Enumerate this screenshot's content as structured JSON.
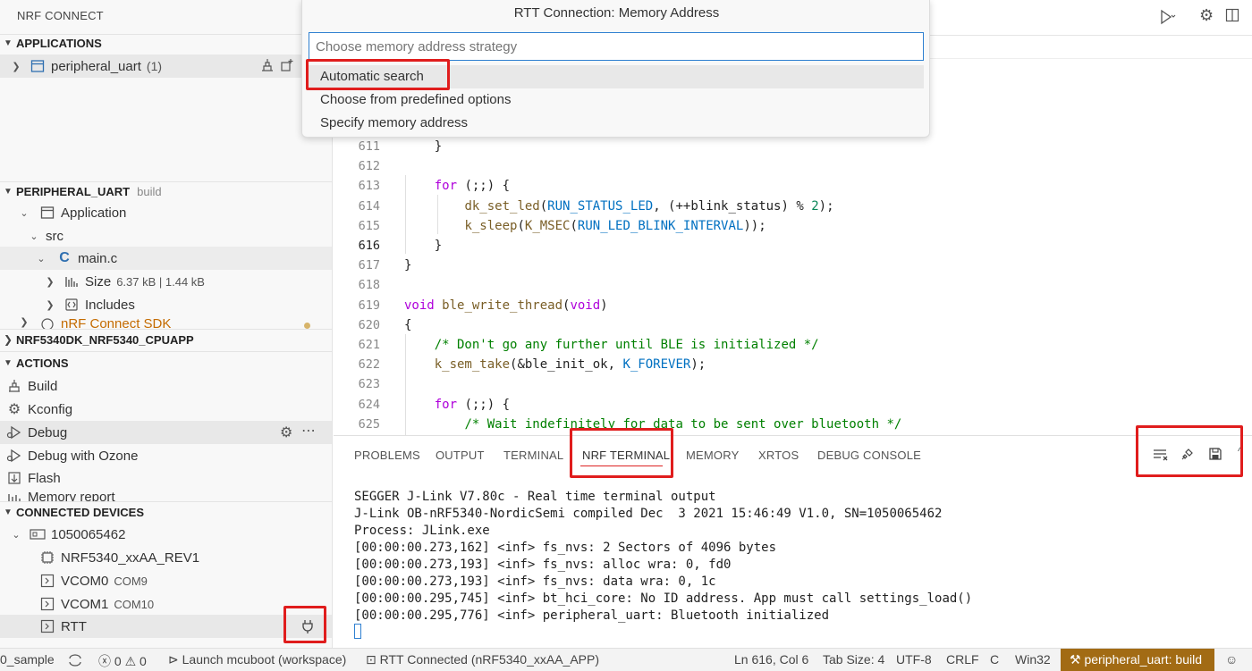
{
  "sidebar": {
    "title": "NRF CONNECT",
    "applications": {
      "header": "APPLICATIONS",
      "items": [
        {
          "label": "peripheral_uart",
          "count": "(1)"
        }
      ]
    },
    "peripheral": {
      "header": "PERIPHERAL_UART",
      "sub": "build",
      "tree": [
        {
          "label": "Application"
        },
        {
          "label": "src"
        },
        {
          "label": "main.c"
        },
        {
          "label": "Size",
          "detail": "6.37 kB | 1.44 kB"
        },
        {
          "label": "Includes"
        },
        {
          "label": "nRF Connect SDK"
        }
      ]
    },
    "board": {
      "header": "NRF5340DK_NRF5340_CPUAPP"
    },
    "actions": {
      "header": "ACTIONS",
      "items": [
        {
          "label": "Build"
        },
        {
          "label": "Kconfig"
        },
        {
          "label": "Debug"
        },
        {
          "label": "Debug with Ozone"
        },
        {
          "label": "Flash"
        },
        {
          "label": "Memory report"
        }
      ]
    },
    "devices": {
      "header": "CONNECTED DEVICES",
      "serial": "1050065462",
      "chip": "NRF5340_xxAA_REV1",
      "vcom0": {
        "label": "VCOM0",
        "port": "COM9"
      },
      "vcom1": {
        "label": "VCOM1",
        "port": "COM10"
      },
      "rtt": "RTT"
    }
  },
  "quickpick": {
    "title": "RTT Connection: Memory Address",
    "placeholder": "Choose memory address strategy",
    "options": [
      "Automatic search",
      "Choose from predefined options",
      "Specify memory address"
    ]
  },
  "editor": {
    "current_line": 616,
    "lines": [
      {
        "n": "611",
        "parts": [
          [
            "    }",
            ""
          ]
        ]
      },
      {
        "n": "612",
        "parts": []
      },
      {
        "n": "613",
        "parts": [
          [
            "    ",
            ""
          ],
          [
            "for",
            "kw"
          ],
          [
            " (;;) {",
            ""
          ]
        ]
      },
      {
        "n": "614",
        "parts": [
          [
            "        ",
            ""
          ],
          [
            "dk_set_led",
            "fn"
          ],
          [
            "(",
            ""
          ],
          [
            "RUN_STATUS_LED",
            "cn"
          ],
          [
            ", (++",
            ""
          ],
          [
            "blink_status",
            ""
          ],
          [
            ") % ",
            ""
          ],
          [
            "2",
            "nm"
          ],
          [
            ");",
            ""
          ]
        ]
      },
      {
        "n": "615",
        "parts": [
          [
            "        ",
            ""
          ],
          [
            "k_sleep",
            "fn"
          ],
          [
            "(",
            ""
          ],
          [
            "K_MSEC",
            "fn"
          ],
          [
            "(",
            ""
          ],
          [
            "RUN_LED_BLINK_INTERVAL",
            "cn"
          ],
          [
            "));",
            ""
          ]
        ]
      },
      {
        "n": "616",
        "parts": [
          [
            "    }",
            ""
          ]
        ]
      },
      {
        "n": "617",
        "parts": [
          [
            "}",
            ""
          ]
        ]
      },
      {
        "n": "618",
        "parts": []
      },
      {
        "n": "619",
        "parts": [
          [
            "void",
            "kw"
          ],
          [
            " ",
            ""
          ],
          [
            "ble_write_thread",
            "fn"
          ],
          [
            "(",
            ""
          ],
          [
            "void",
            "kw"
          ],
          [
            ")",
            ""
          ]
        ]
      },
      {
        "n": "620",
        "parts": [
          [
            "{",
            ""
          ]
        ]
      },
      {
        "n": "621",
        "parts": [
          [
            "    ",
            ""
          ],
          [
            "/* Don't go any further until BLE is initialized */",
            "cm"
          ]
        ]
      },
      {
        "n": "622",
        "parts": [
          [
            "    ",
            ""
          ],
          [
            "k_sem_take",
            "fn"
          ],
          [
            "(&",
            ""
          ],
          [
            "ble_init_ok",
            ""
          ],
          [
            ", ",
            ""
          ],
          [
            "K_FOREVER",
            "cn"
          ],
          [
            ");",
            ""
          ]
        ]
      },
      {
        "n": "623",
        "parts": []
      },
      {
        "n": "624",
        "parts": [
          [
            "    ",
            ""
          ],
          [
            "for",
            "kw"
          ],
          [
            " (;;) {",
            ""
          ]
        ]
      },
      {
        "n": "625",
        "parts": [
          [
            "        ",
            ""
          ],
          [
            "/* Wait indefinitely for data to be sent over bluetooth */",
            "cm"
          ]
        ]
      }
    ]
  },
  "panel": {
    "tabs": [
      "PROBLEMS",
      "OUTPUT",
      "TERMINAL",
      "NRF TERMINAL",
      "MEMORY",
      "XRTOS",
      "DEBUG CONSOLE"
    ],
    "active_tab": "NRF TERMINAL",
    "terminal": [
      "SEGGER J-Link V7.80c - Real time terminal output",
      "J-Link OB-nRF5340-NordicSemi compiled Dec  3 2021 15:46:49 V1.0, SN=1050065462",
      "Process: JLink.exe",
      "[00:00:00.273,162] <inf> fs_nvs: 2 Sectors of 4096 bytes",
      "[00:00:00.273,193] <inf> fs_nvs: alloc wra: 0, fd0",
      "[00:00:00.273,193] <inf> fs_nvs: data wra: 0, 1c",
      "[00:00:00.295,745] <inf> bt_hci_core: No ID address. App must call settings_load()",
      "[00:00:00.295,776] <inf> peripheral_uart: Bluetooth initialized"
    ]
  },
  "status": {
    "sample": "0_sample",
    "errors": "0",
    "warnings": "0",
    "launch": "Launch mcuboot (workspace)",
    "rtt": "RTT Connected (nRF5340_xxAA_APP)",
    "position": "Ln 616, Col 6",
    "tabsize": "Tab Size: 4",
    "encoding": "UTF-8",
    "eol": "CRLF",
    "language": "C",
    "platform": "Win32",
    "build": "peripheral_uart: build"
  },
  "colors": {
    "accent_red": "#e01d1d",
    "build_badge": "#a26b14",
    "focus_blue": "#2f80d1"
  }
}
